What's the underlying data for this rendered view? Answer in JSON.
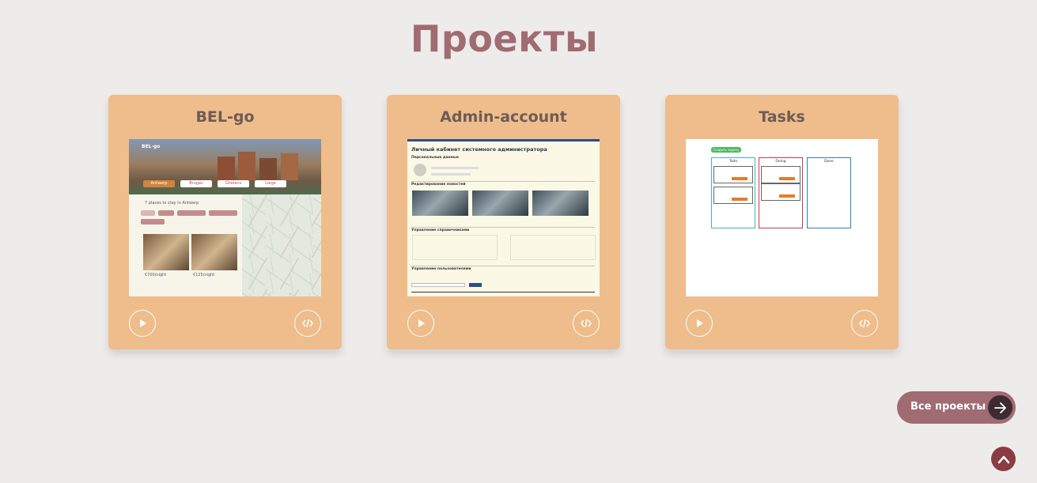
{
  "section_title": "Проекты",
  "projects": [
    {
      "title": "BEL-go",
      "preview": {
        "logo": "BEL-go",
        "tabs": [
          "Antwerp",
          "Bruges",
          "Ghelens",
          "Liege"
        ],
        "heading": "7 places to stay in Antwerp",
        "filters": [
          "All",
          "Regular",
          "Price low to high",
          "Price high to low",
          "Top rated first"
        ],
        "listing_prices": [
          "€700/night",
          "€125/night"
        ]
      }
    },
    {
      "title": "Admin-account",
      "preview": {
        "heading": "Личный кабинет системного администратора",
        "sections": [
          "Персональные данные",
          "Редактирование новостей",
          "Управление справочниками",
          "Управление пользователями"
        ],
        "search_button": "Поиск"
      }
    },
    {
      "title": "Tasks",
      "preview": {
        "add_button": "Создать задачу",
        "columns": [
          "Todo",
          "Doing",
          "Done"
        ],
        "column_colors": [
          "#3fb8b5",
          "#c33d4a",
          "#2f7fc0"
        ]
      }
    }
  ],
  "icons": {
    "play": "play-icon",
    "code": "code-icon",
    "arrow": "arrow-right-icon",
    "scroll_top": "chevron-up-icon"
  },
  "all_projects_label": "Все проекты",
  "colors": {
    "background": "#eeebeb",
    "accent": "#a06b72",
    "card": "#eebd8b",
    "title": "#6c5c56"
  }
}
